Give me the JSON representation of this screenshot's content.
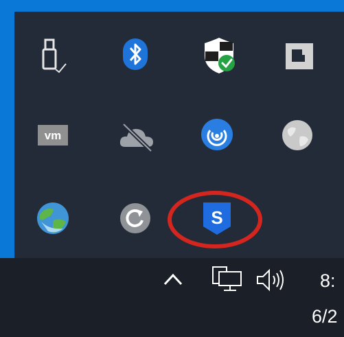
{
  "tray_overflow": {
    "icons": [
      "usb-safely-remove-icon",
      "bluetooth-icon",
      "windows-security-icon",
      "square-app-icon",
      "vmware-icon",
      "onedrive-offline-icon",
      "webex-icon",
      "globe-gray-icon",
      "globe-network-icon",
      "refresh-sync-icon",
      "sophos-shield-icon"
    ],
    "sophos_letter": "S"
  },
  "highlight": {
    "color": "#d4261f"
  },
  "taskbar": {
    "icons": [
      "show-hidden-icons-chevron",
      "network-icon",
      "volume-icon"
    ],
    "clock_time": "8:",
    "clock_date": "6/2"
  },
  "colors": {
    "desktop_blue": "#0a78d7",
    "popup_bg": "#242b38",
    "taskbar_bg": "#1b1f27",
    "bluetooth": "#1f74d9",
    "sophos": "#1f6ce0",
    "shield_green": "#25a244"
  }
}
